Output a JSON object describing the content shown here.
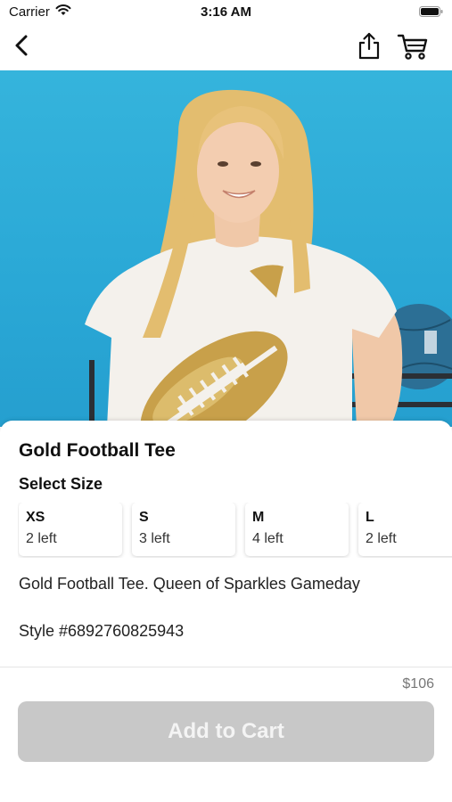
{
  "status_bar": {
    "carrier": "Carrier",
    "time": "3:16 AM"
  },
  "nav": {
    "back_icon": "chevron-left-icon",
    "share_icon": "share-icon",
    "cart_icon": "cart-icon"
  },
  "product": {
    "name": "Gold Football Tee",
    "select_size_label": "Select Size",
    "sizes": [
      {
        "size": "XS",
        "stock": "2 left"
      },
      {
        "size": "S",
        "stock": "3 left"
      },
      {
        "size": "M",
        "stock": "4 left"
      },
      {
        "size": "L",
        "stock": "2 left"
      }
    ],
    "description": "Gold Football Tee. Queen of Sparkles Gameday",
    "style": "Style #6892760825943"
  },
  "footer": {
    "price": "$106",
    "add_to_cart": "Add to Cart"
  },
  "colors": {
    "hero_background": "#2aa8d6",
    "button_disabled": "#c8c8c8",
    "sequin_gold": "#c8a04a"
  }
}
